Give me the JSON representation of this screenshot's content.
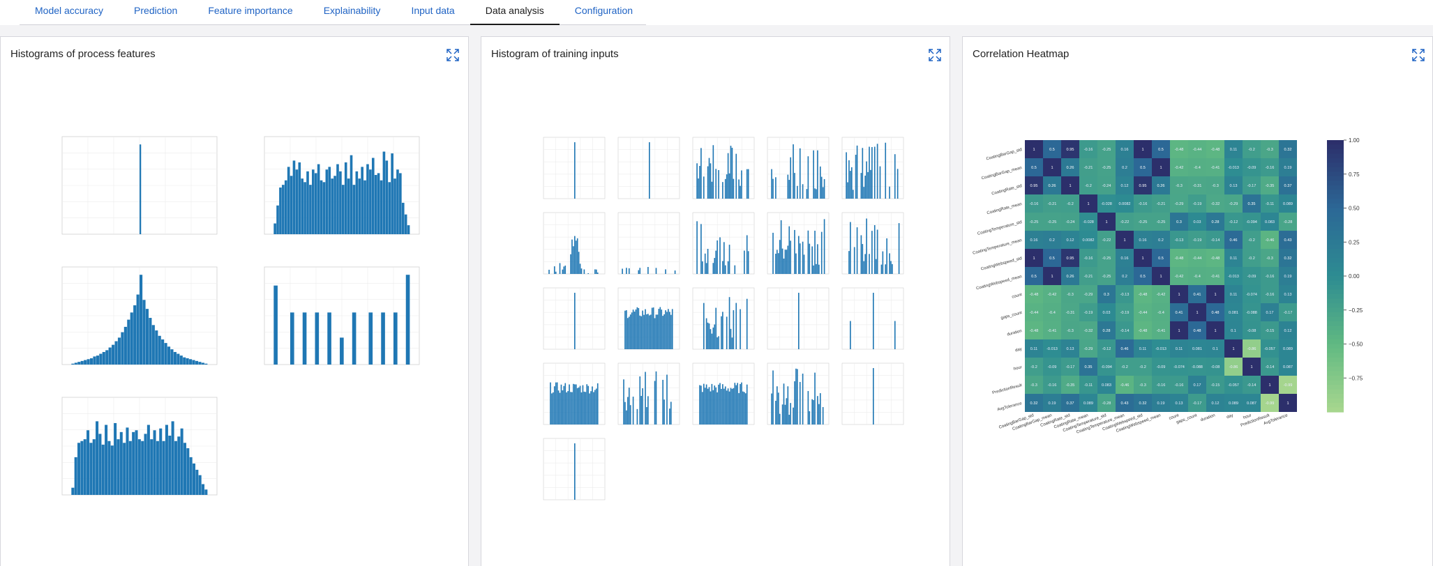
{
  "tabs": [
    {
      "label": "Model accuracy"
    },
    {
      "label": "Prediction"
    },
    {
      "label": "Feature importance"
    },
    {
      "label": "Explainability"
    },
    {
      "label": "Input data"
    },
    {
      "label": "Data analysis",
      "active": true
    },
    {
      "label": "Configuration"
    }
  ],
  "panels": [
    {
      "title": "Histograms of process features",
      "expand_icon": "expand-icon"
    },
    {
      "title": "Histogram of training inputs",
      "expand_icon": "expand-icon"
    },
    {
      "title": "Correlation Heatmap",
      "expand_icon": "expand-icon"
    }
  ],
  "colors": {
    "accent": "#1f63c4",
    "bar": "#1f77b4",
    "heat_high": "#2c2f6b",
    "heat_mid": "#2a8a93",
    "heat_low": "#9ccf8c"
  },
  "chart_data": [
    {
      "type": "bar",
      "title": "Histograms of process features",
      "subplots": [
        {
          "shape": "spike",
          "bins": [
            0,
            0,
            0,
            0,
            0,
            0,
            0,
            0,
            0,
            0,
            0,
            0,
            0,
            0,
            0,
            0,
            0,
            0,
            0,
            0,
            0,
            0,
            0,
            0,
            0,
            0,
            0,
            0,
            0,
            0,
            0,
            0,
            0,
            0,
            0,
            0,
            0,
            0,
            1,
            0,
            0,
            0,
            0,
            0,
            0,
            0,
            0,
            0,
            0,
            0,
            0,
            0,
            0,
            0,
            0,
            0,
            0,
            0,
            0,
            0,
            0,
            0,
            0,
            0,
            0,
            0,
            0,
            0,
            0,
            0,
            0,
            0,
            0,
            0,
            0,
            0
          ]
        },
        {
          "shape": "uniform",
          "bins": [
            0.12,
            0.32,
            0.52,
            0.55,
            0.6,
            0.75,
            0.65,
            0.82,
            0.72,
            0.8,
            0.62,
            0.58,
            0.7,
            0.55,
            0.72,
            0.68,
            0.78,
            0.6,
            0.58,
            0.72,
            0.75,
            0.62,
            0.65,
            0.78,
            0.7,
            0.55,
            0.8,
            0.62,
            0.88,
            0.55,
            0.7,
            0.62,
            0.75,
            0.6,
            0.78,
            0.72,
            0.85,
            0.66,
            0.68,
            0.6,
            0.92,
            0.82,
            0.58,
            0.9,
            0.62,
            0.72,
            0.68,
            0.35,
            0.22,
            0.1
          ]
        },
        {
          "shape": "peaked",
          "bins": [
            0.01,
            0.02,
            0.03,
            0.04,
            0.05,
            0.06,
            0.07,
            0.09,
            0.1,
            0.12,
            0.14,
            0.16,
            0.19,
            0.22,
            0.26,
            0.3,
            0.36,
            0.42,
            0.5,
            0.58,
            0.66,
            0.78,
            1.0,
            0.72,
            0.62,
            0.52,
            0.44,
            0.38,
            0.32,
            0.28,
            0.24,
            0.2,
            0.17,
            0.14,
            0.12,
            0.1,
            0.08,
            0.07,
            0.06,
            0.05,
            0.04,
            0.03,
            0.02,
            0.01
          ]
        },
        {
          "shape": "discrete",
          "bins": [
            0.88,
            0,
            0,
            0,
            0.58,
            0,
            0,
            0.58,
            0,
            0,
            0.58,
            0,
            0,
            0.58,
            0,
            0,
            0.3,
            0,
            0,
            0.58,
            0,
            0,
            0,
            0.58,
            0,
            0,
            0.58,
            0,
            0,
            0.58,
            0,
            0,
            1.0
          ]
        },
        {
          "shape": "uniform",
          "bins": [
            0.08,
            0.42,
            0.58,
            0.6,
            0.62,
            0.72,
            0.58,
            0.62,
            0.82,
            0.68,
            0.56,
            0.78,
            0.6,
            0.55,
            0.8,
            0.62,
            0.7,
            0.58,
            0.75,
            0.6,
            0.7,
            0.72,
            0.62,
            0.6,
            0.68,
            0.78,
            0.62,
            0.72,
            0.6,
            0.74,
            0.6,
            0.78,
            0.66,
            0.82,
            0.6,
            0.65,
            0.74,
            0.58,
            0.52,
            0.42,
            0.35,
            0.28,
            0.22,
            0.12,
            0.06
          ]
        }
      ]
    },
    {
      "type": "bar",
      "title": "Histogram of training inputs",
      "subplots_count": 21
    },
    {
      "type": "heatmap",
      "title": "Correlation Heatmap",
      "matrix": [
        [
          1,
          0.5,
          0.95,
          -0.16,
          -0.25,
          0.16,
          1,
          0.5,
          -0.48,
          -0.44,
          -0.48,
          0.11,
          -0.2,
          -0.3,
          0.32
        ],
        [
          0.5,
          1,
          0.26,
          -0.21,
          -0.25,
          0.2,
          0.5,
          1,
          -0.42,
          -0.4,
          -0.41,
          -0.013,
          -0.09,
          -0.16,
          0.19
        ],
        [
          0.95,
          0.26,
          1,
          -0.2,
          -0.24,
          0.12,
          0.95,
          0.26,
          -0.3,
          -0.31,
          -0.3,
          0.13,
          -0.17,
          -0.35,
          0.37
        ],
        [
          -0.16,
          -0.21,
          -0.2,
          1,
          -0.028,
          0.0082,
          -0.16,
          -0.21,
          -0.29,
          -0.19,
          -0.32,
          -0.29,
          0.35,
          -0.11,
          0.089
        ],
        [
          -0.25,
          -0.25,
          -0.24,
          -0.028,
          1,
          -0.22,
          -0.25,
          -0.25,
          0.3,
          0.03,
          0.28,
          -0.12,
          -0.094,
          0.083,
          -0.28
        ],
        [
          0.16,
          0.2,
          0.12,
          0.0082,
          -0.22,
          1,
          0.16,
          0.2,
          -0.13,
          -0.19,
          -0.14,
          0.46,
          -0.2,
          -0.46,
          0.43
        ],
        [
          1,
          0.5,
          0.95,
          -0.16,
          -0.25,
          0.16,
          1,
          0.5,
          -0.48,
          -0.44,
          -0.48,
          0.11,
          -0.2,
          -0.3,
          0.32
        ],
        [
          0.5,
          1,
          0.26,
          -0.21,
          -0.25,
          0.2,
          0.5,
          1,
          -0.42,
          -0.4,
          -0.41,
          -0.013,
          -0.09,
          -0.16,
          0.19
        ],
        [
          -0.48,
          -0.42,
          -0.3,
          -0.29,
          0.3,
          -0.13,
          -0.48,
          -0.42,
          1,
          0.41,
          1,
          0.11,
          -0.074,
          -0.16,
          0.13
        ],
        [
          -0.44,
          -0.4,
          -0.31,
          -0.19,
          0.03,
          -0.19,
          -0.44,
          -0.4,
          0.41,
          1,
          0.48,
          0.081,
          -0.088,
          0.17,
          -0.17
        ],
        [
          -0.48,
          -0.41,
          -0.3,
          -0.32,
          0.28,
          -0.14,
          -0.48,
          -0.41,
          1,
          0.48,
          1,
          0.1,
          -0.08,
          -0.15,
          0.12
        ],
        [
          0.11,
          -0.013,
          0.13,
          -0.29,
          -0.12,
          0.46,
          0.11,
          -0.013,
          0.11,
          0.081,
          0.1,
          1,
          -0.86,
          -0.057,
          0.089
        ],
        [
          -0.2,
          -0.09,
          -0.17,
          0.35,
          -0.094,
          -0.2,
          -0.2,
          -0.09,
          -0.074,
          -0.088,
          -0.08,
          -0.86,
          1,
          -0.14,
          0.087
        ],
        [
          -0.3,
          -0.16,
          -0.35,
          -0.11,
          0.083,
          -0.46,
          -0.3,
          -0.16,
          -0.16,
          0.17,
          -0.15,
          -0.057,
          -0.14,
          1,
          -0.99
        ],
        [
          0.32,
          0.19,
          0.37,
          0.089,
          -0.28,
          0.43,
          0.32,
          0.19,
          0.13,
          -0.17,
          0.12,
          0.089,
          0.087,
          -0.99,
          1
        ]
      ],
      "row_labels": [
        "CoatingBarGap_std",
        "CoatingBarGap_mean",
        "CoatingRate_std",
        "CoatingRate_mean",
        "CoatingTemperature_std",
        "CoatingTemperature_mean",
        "CoatingWebspeed_std",
        "CoatingWebspeed_mean",
        "count",
        "gaps_count",
        "duration",
        "day",
        "hour",
        "PredictionResult",
        "AvgTolerance"
      ],
      "colorbar": {
        "ticks": [
          "1.00",
          "0.75",
          "0.50",
          "0.25",
          "0.00",
          "−0.25",
          "−0.50",
          "−0.75"
        ],
        "range": [
          -1,
          1
        ]
      }
    }
  ]
}
